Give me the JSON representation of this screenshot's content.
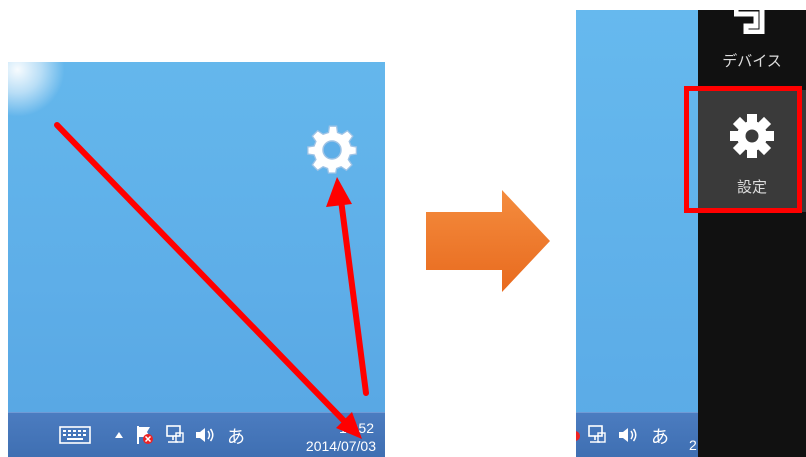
{
  "left_screen": {
    "taskbar": {
      "clock_time": "14:52",
      "clock_date": "2014/07/03",
      "ime_char": "あ",
      "show_hidden_icon": "triangle-up-icon"
    },
    "desktop_gear_icon": "gear-icon"
  },
  "transition_arrow": {
    "color": "#f0782a"
  },
  "right_screen": {
    "charms": [
      {
        "label": "デバイス",
        "icon": "devices-icon"
      },
      {
        "label": "設定",
        "icon": "gear-icon"
      }
    ],
    "taskbar": {
      "ime_char": "あ",
      "clock_partial": "2"
    }
  },
  "annotations": {
    "arrow_color": "#ff0000",
    "highlight_color": "#ff0000"
  }
}
